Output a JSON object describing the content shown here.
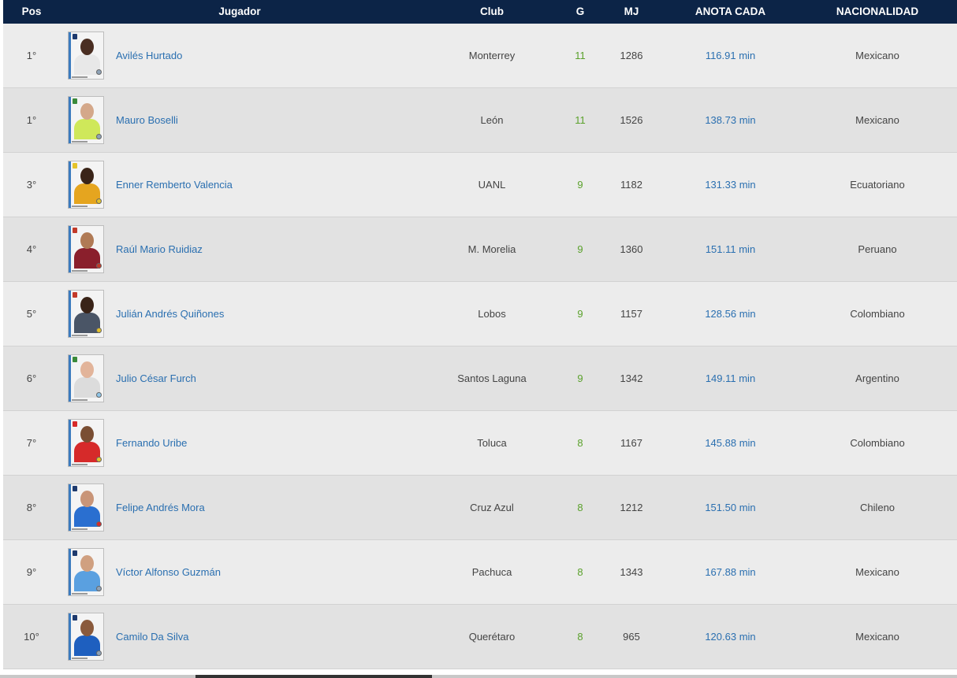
{
  "headers": {
    "pos": "Pos",
    "jugador": "Jugador",
    "club": "Club",
    "g": "G",
    "mj": "MJ",
    "anota": "ANOTA CADA",
    "nacionalidad": "NACIONALIDAD"
  },
  "rows": [
    {
      "pos": "1°",
      "name": "Avilés Hurtado",
      "club": "Monterrey",
      "g": "11",
      "mj": "1286",
      "anota": "116.91 min",
      "nac": "Mexicano",
      "skin": "#4a2e22",
      "shirt": "#e8e8e8",
      "badge": "#1e3a6e",
      "flag": "#8fa3b8"
    },
    {
      "pos": "1°",
      "name": "Mauro Boselli",
      "club": "León",
      "g": "11",
      "mj": "1526",
      "anota": "138.73 min",
      "nac": "Mexicano",
      "skin": "#d4a88a",
      "shirt": "#cfe85a",
      "badge": "#3b8a3b",
      "flag": "#8fa3b8"
    },
    {
      "pos": "3°",
      "name": "Enner Remberto Valencia",
      "club": "UANL",
      "g": "9",
      "mj": "1182",
      "anota": "131.33 min",
      "nac": "Ecuatoriano",
      "skin": "#3a2418",
      "shirt": "#e5a51f",
      "badge": "#e5c32a",
      "flag": "#e5c32a"
    },
    {
      "pos": "4°",
      "name": "Raúl Mario Ruidiaz",
      "club": "M. Morelia",
      "g": "9",
      "mj": "1360",
      "anota": "151.11 min",
      "nac": "Peruano",
      "skin": "#b07a55",
      "shirt": "#8a1f2c",
      "badge": "#c23a2a",
      "flag": "#c23a2a"
    },
    {
      "pos": "5°",
      "name": "Julián Andrés Quiñones",
      "club": "Lobos",
      "g": "9",
      "mj": "1157",
      "anota": "128.56 min",
      "nac": "Colombiano",
      "skin": "#3a2418",
      "shirt": "#4a5566",
      "badge": "#c23a2a",
      "flag": "#e5c32a"
    },
    {
      "pos": "6°",
      "name": "Julio César Furch",
      "club": "Santos Laguna",
      "g": "9",
      "mj": "1342",
      "anota": "149.11 min",
      "nac": "Argentino",
      "skin": "#e2b49a",
      "shirt": "#dcdcdc",
      "badge": "#3b8a3b",
      "flag": "#8ec5e8"
    },
    {
      "pos": "7°",
      "name": "Fernando Uribe",
      "club": "Toluca",
      "g": "8",
      "mj": "1167",
      "anota": "145.88 min",
      "nac": "Colombiano",
      "skin": "#7a4e33",
      "shirt": "#d62a2a",
      "badge": "#d62a2a",
      "flag": "#e5c32a"
    },
    {
      "pos": "8°",
      "name": "Felipe Andrés Mora",
      "club": "Cruz Azul",
      "g": "8",
      "mj": "1212",
      "anota": "151.50 min",
      "nac": "Chileno",
      "skin": "#c99578",
      "shirt": "#2a6fd0",
      "badge": "#1e3a6e",
      "flag": "#d62a2a"
    },
    {
      "pos": "9°",
      "name": "Víctor Alfonso Guzmán",
      "club": "Pachuca",
      "g": "8",
      "mj": "1343",
      "anota": "167.88 min",
      "nac": "Mexicano",
      "skin": "#d0a080",
      "shirt": "#5aa0e0",
      "badge": "#1e3a6e",
      "flag": "#8fa3b8"
    },
    {
      "pos": "10°",
      "name": "Camilo Da Silva",
      "club": "Querétaro",
      "g": "8",
      "mj": "965",
      "anota": "120.63 min",
      "nac": "Mexicano",
      "skin": "#8a5a3c",
      "shirt": "#1e5fbf",
      "badge": "#1e3a6e",
      "flag": "#8fa3b8"
    }
  ]
}
